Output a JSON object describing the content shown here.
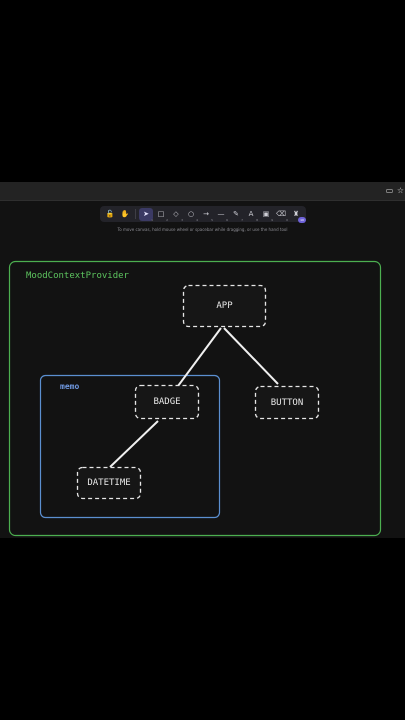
{
  "hint_text": "To move canvas, hold mouse wheel or spacebar while dragging, or use the hand tool",
  "browser": {
    "icons": [
      "cast-icon",
      "star-icon"
    ]
  },
  "toolbar": {
    "tools": [
      {
        "name": "lock-icon",
        "glyph": "🔓",
        "num": ""
      },
      {
        "name": "hand-icon",
        "glyph": "✋",
        "num": ""
      },
      {
        "name": "selection-icon",
        "glyph": "➤",
        "num": "1",
        "active": true
      },
      {
        "name": "rectangle-icon",
        "glyph": "□",
        "num": "2"
      },
      {
        "name": "diamond-icon",
        "glyph": "◇",
        "num": "3"
      },
      {
        "name": "ellipse-icon",
        "glyph": "○",
        "num": "4"
      },
      {
        "name": "arrow-icon",
        "glyph": "→",
        "num": "5"
      },
      {
        "name": "line-icon",
        "glyph": "—",
        "num": "6"
      },
      {
        "name": "draw-icon",
        "glyph": "✎",
        "num": "7"
      },
      {
        "name": "text-icon",
        "glyph": "A",
        "num": "8"
      },
      {
        "name": "image-icon",
        "glyph": "▣",
        "num": "9"
      },
      {
        "name": "eraser-icon",
        "glyph": "⌫",
        "num": "0"
      },
      {
        "name": "library-icon",
        "glyph": "♜",
        "badge": "10"
      }
    ]
  },
  "diagram": {
    "outer_container_label": "MoodContextProvider",
    "inner_container_label": "memo",
    "nodes": {
      "app": "APP",
      "badge": "BADGE",
      "button": "BUTTON",
      "datetime": "DATETIME"
    },
    "colors": {
      "outer_border": "#4caf50",
      "outer_label": "#5dc45f",
      "inner_border": "#5b8fd0",
      "inner_label": "#6f98e0",
      "node_border": "#e6e6e6",
      "edge": "#f0f0f0"
    }
  }
}
